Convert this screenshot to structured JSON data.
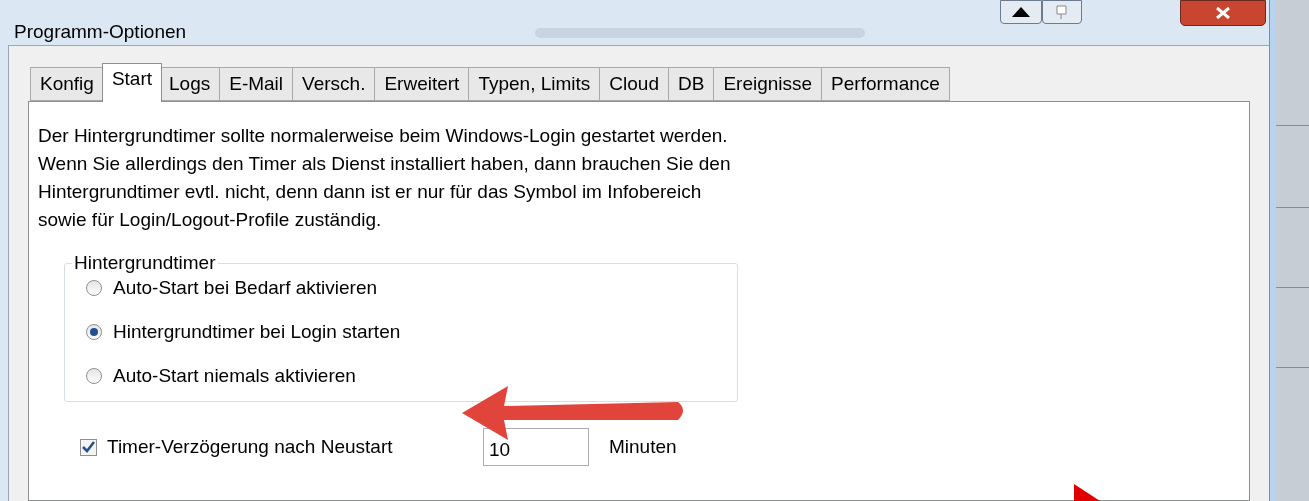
{
  "window": {
    "title": "Programm-Optionen"
  },
  "tabs": [
    {
      "label": "Konfig",
      "selected": false
    },
    {
      "label": "Start",
      "selected": true
    },
    {
      "label": "Logs",
      "selected": false
    },
    {
      "label": "E-Mail",
      "selected": false
    },
    {
      "label": "Versch.",
      "selected": false
    },
    {
      "label": "Erweitert",
      "selected": false
    },
    {
      "label": "Typen, Limits",
      "selected": false
    },
    {
      "label": "Cloud",
      "selected": false
    },
    {
      "label": "DB",
      "selected": false
    },
    {
      "label": "Ereignisse",
      "selected": false
    },
    {
      "label": "Performance",
      "selected": false
    }
  ],
  "intro_text": "Der Hintergrundtimer sollte normalerweise beim Windows-Login gestartet werden.\nWenn Sie allerdings den Timer als Dienst installiert haben, dann brauchen Sie den\nHintergrundtimer evtl. nicht, denn dann ist er nur für das Symbol im Infobereich\nsowie für Login/Logout-Profile zuständig.",
  "group": {
    "title": "Hintergrundtimer",
    "options": [
      {
        "label": "Auto-Start bei Bedarf aktivieren",
        "selected": false
      },
      {
        "label": "Hintergrundtimer bei Login starten",
        "selected": true
      },
      {
        "label": "Auto-Start niemals aktivieren",
        "selected": false
      }
    ]
  },
  "timer_delay": {
    "label": "Timer-Verzögerung nach Neustart",
    "checked": true,
    "value": "10",
    "unit": "Minuten"
  }
}
